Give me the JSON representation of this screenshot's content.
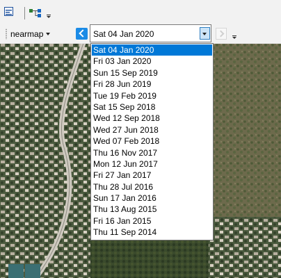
{
  "toolbar": {
    "layers_icon": "layers-panel-icon",
    "network_icon": "network-tree-icon",
    "overflow_icon": "toolbar-overflow-icon"
  },
  "imagery_toolbar": {
    "provider": "nearmap",
    "prev_icon": "chevron-left-icon",
    "next_icon": "chevron-right-icon",
    "selected_date": "Sat 04 Jan 2020"
  },
  "date_options": [
    "Sat 04 Jan 2020",
    "Fri 03 Jan 2020",
    "Sun 15 Sep 2019",
    "Fri 28 Jun 2019",
    "Tue 19 Feb 2019",
    "Sat 15 Sep 2018",
    "Wed 12 Sep 2018",
    "Wed 27 Jun 2018",
    "Wed 07 Feb 2018",
    "Thu 16 Nov 2017",
    "Mon 12 Jun 2017",
    "Fri 27 Jan 2017",
    "Thu 28 Jul 2016",
    "Sun 17 Jan 2016",
    "Thu 13 Aug 2015",
    "Fri 16 Jan 2015",
    "Thu 11 Sep 2014"
  ],
  "colors": {
    "accent": "#0078d7",
    "nav_button": "#1b8be6",
    "toolbar_bg": "#f2f2f2"
  }
}
